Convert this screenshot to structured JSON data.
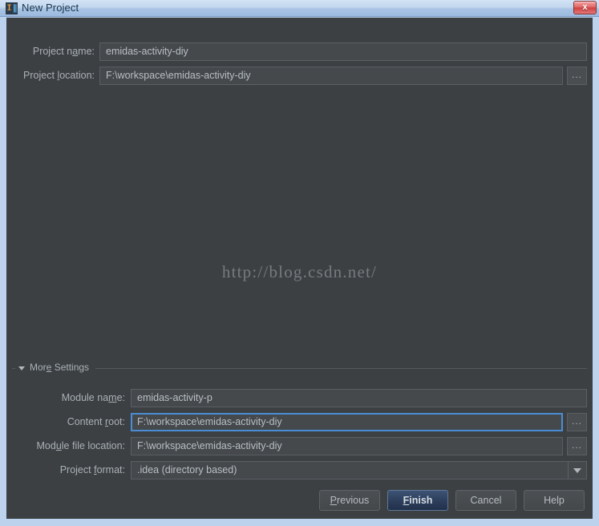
{
  "window": {
    "title": "New Project",
    "app_icon": "intellij-idea-icon",
    "close_label": "x",
    "frame_color": "#bdd2ec",
    "dialog_bg": "#3c4043"
  },
  "top_form": {
    "rows": [
      {
        "label_pre": "Project n",
        "label_mnemonic": "a",
        "label_post": "me:",
        "value": "emidas-activity-diy",
        "has_browse": false
      },
      {
        "label_pre": "Project ",
        "label_mnemonic": "l",
        "label_post": "ocation:",
        "value": "F:\\workspace\\emidas-activity-diy",
        "has_browse": true,
        "browse_label": "..."
      }
    ]
  },
  "watermark": {
    "text": "http://blog.csdn.net/"
  },
  "more_settings": {
    "label_pre": "Mor",
    "label_mnemonic": "e",
    "label_post": " Settings",
    "expanded": true,
    "rows": [
      {
        "label_pre": "Module na",
        "label_mnemonic": "m",
        "label_post": "e:",
        "value": "emidas-activity-p",
        "has_browse": false,
        "focused": false,
        "is_combo": false
      },
      {
        "label_pre": "Content ",
        "label_mnemonic": "r",
        "label_post": "oot:",
        "value": "F:\\workspace\\emidas-activity-diy",
        "has_browse": true,
        "browse_label": "...",
        "focused": true,
        "is_combo": false
      },
      {
        "label_pre": "Mod",
        "label_mnemonic": "u",
        "label_post": "le file location:",
        "value": "F:\\workspace\\emidas-activity-diy",
        "has_browse": true,
        "browse_label": "...",
        "focused": false,
        "is_combo": false
      },
      {
        "label_pre": "Project ",
        "label_mnemonic": "f",
        "label_post": "ormat:",
        "value": ".idea (directory based)",
        "has_browse": false,
        "focused": false,
        "is_combo": true
      }
    ]
  },
  "buttons": [
    {
      "pre": "",
      "mnemonic": "P",
      "post": "revious",
      "default": false
    },
    {
      "pre": "",
      "mnemonic": "F",
      "post": "inish",
      "default": true
    },
    {
      "pre": "Cancel",
      "mnemonic": "",
      "post": "",
      "default": false
    },
    {
      "pre": "Help",
      "mnemonic": "",
      "post": "",
      "default": false
    }
  ]
}
